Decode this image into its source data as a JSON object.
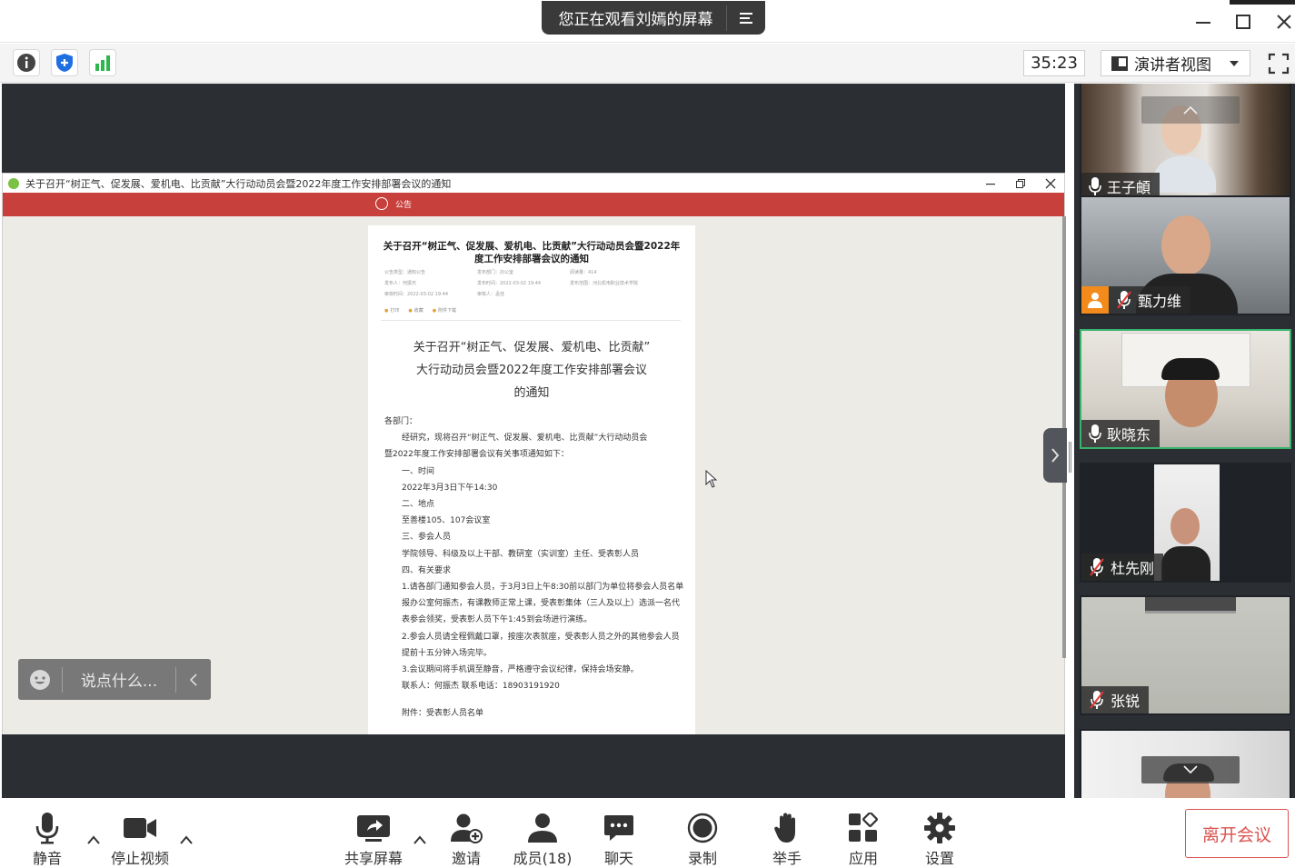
{
  "window": {
    "sharing_banner": "您正在观看刘嫣的屏幕"
  },
  "toolbar": {
    "timer": "35:23",
    "view_mode": "演讲者视图"
  },
  "shared_window": {
    "title": "关于召开“树正气、促发展、爱机电、比贡献”大行动动员会暨2022年度工作安排部署会议的通知",
    "banner_label": "公告",
    "doc": {
      "header_title": "关于召开“树正气、促发展、爱机电、比贡献”大行动动员会暨2022年度工作安排部署会议的通知",
      "meta": [
        "公告类型：通知公告",
        "发布部门：办公室",
        "阅读量：414",
        "发布人：何振杰",
        "发布时间：2022-03-02 19:44",
        "发布范围：河北机电职业技术学院",
        "审核时间：2022-03-02 19:44",
        "审核人：孟佳"
      ],
      "actions": [
        "打印",
        "收藏",
        "附件下载"
      ],
      "big_title_lines": [
        "关于召开“树正气、促发展、爱机电、比贡献”",
        "大行动动员会暨2022年度工作安排部署会议",
        "的通知"
      ],
      "salutation": "各部门：",
      "intro_line1": "经研究，现将召开“树正气、促发展、爱机电、比贡献”大行动动员会",
      "intro_line2": "暨2022年度工作安排部署会议有关事项通知如下：",
      "sec1": "一、时间",
      "sec1_val": "2022年3月3日下午14:30",
      "sec2": "二、地点",
      "sec2_val": "至善楼105、107会议室",
      "sec3": "三、参会人员",
      "sec3_val": "学院领导、科级及以上干部、教研室（实训室）主任、受表彰人员",
      "sec4": "四、有关要求",
      "req1": "1.请各部门通知参会人员，于3月3日上午8:30前以部门为单位将参会人员名单报办公室何振杰，有课教师正常上课，受表彰集体（三人及以上）选派一名代表参会领奖，受表彰人员下午1:45到会场进行演练。",
      "req2": "2.参会人员请全程佩戴口罩，按座次表就座，受表彰人员之外的其他参会人员提前十五分钟入场完毕。",
      "req3": "3.会议期间将手机调至静音，严格遵守会议纪律，保持会场安静。",
      "contact": "联系人：何振杰    联系电话：18903191920",
      "attachment": "附件：受表彰人员名单"
    }
  },
  "chat": {
    "placeholder": "说点什么..."
  },
  "participants": [
    {
      "name": "王子頔",
      "muted": false
    },
    {
      "name": "甄力维",
      "muted": true
    },
    {
      "name": "耿晓东",
      "muted": false
    },
    {
      "name": "杜先刚",
      "muted": true
    },
    {
      "name": "张锐",
      "muted": true
    }
  ],
  "controls": {
    "mute": "静音",
    "stop_video": "停止视频",
    "share_screen": "共享屏幕",
    "invite": "邀请",
    "members": "成员(18)",
    "chat": "聊天",
    "record": "录制",
    "raise_hand": "举手",
    "apps": "应用",
    "settings": "设置",
    "leave": "离开会议"
  },
  "colors": {
    "accent_red": "#c8403b",
    "leave_red": "#d9534f",
    "active_speaker": "#37b36b",
    "stage_bg": "#2b2e33",
    "shield_blue": "#1f6fe0",
    "signal_green": "#2db84d"
  }
}
